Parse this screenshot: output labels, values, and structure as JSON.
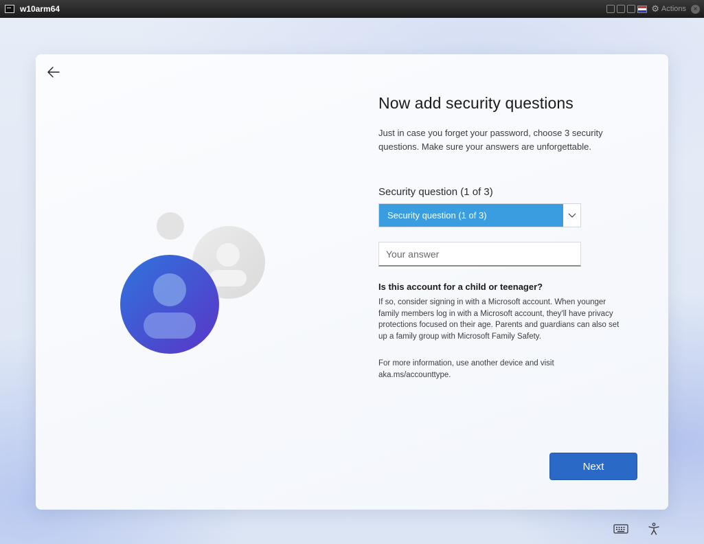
{
  "window": {
    "title": "w10arm64",
    "actions_label": "Actions"
  },
  "dialog": {
    "heading": "Now add security questions",
    "subtitle": "Just in case you forget your password, choose 3 security questions. Make sure your answers are unforgettable.",
    "question_label": "Security question (1 of 3)",
    "question_select_value": "Security question (1 of 3)",
    "answer_placeholder": "Your answer",
    "answer_value": "",
    "child_heading": "Is this account for a child or teenager?",
    "child_body": "If so, consider signing in with a Microsoft account. When younger family members log in with a Microsoft account, they'll have privacy protections focused on their age. Parents and guardians can also set up a family group with Microsoft Family Safety.",
    "more_info": "For more information, use another device and visit aka.ms/accounttype.",
    "next_label": "Next"
  },
  "icons": {
    "back": "back-arrow-icon",
    "dropdown": "chevron-down-icon",
    "illustration": "user-accounts-icon",
    "keyboard": "keyboard-icon",
    "accessibility": "accessibility-icon"
  },
  "colors": {
    "accent": "#2a69c6",
    "select_highlight": "#3a9ddf",
    "avatar_primary": "#3b5fd6",
    "avatar_secondary": "#e4e4e4"
  }
}
